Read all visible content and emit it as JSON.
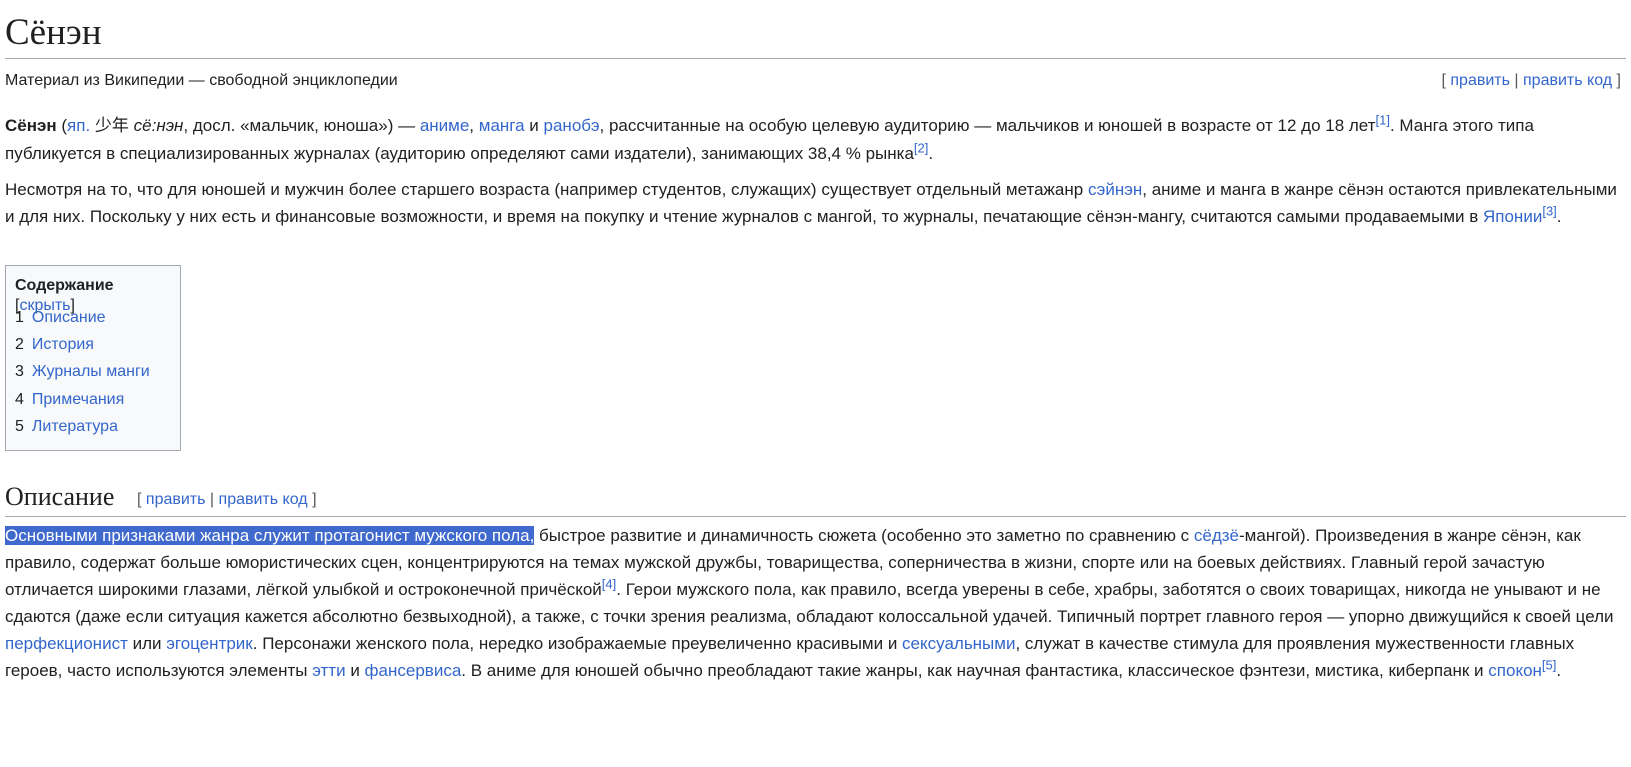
{
  "page": {
    "title": "Сёнэн",
    "tagline": "Материал из Википедии — свободной энциклопедии",
    "edit_links": {
      "open": "[",
      "edit": "править",
      "sep": "|",
      "edit_source": "править код",
      "close": "]"
    }
  },
  "paragraph1": {
    "term": "Сёнэн",
    "t1": " (",
    "lang_link": "яп.",
    "t2": " ",
    "kanji": "少年",
    "t3": " ",
    "romaji": "сё:нэн",
    "t4": ", досл. «мальчик, юноша») — ",
    "link_anime": "аниме",
    "t5": ", ",
    "link_manga": "манга",
    "t6": " и ",
    "link_ranobe": "ранобэ",
    "t7": ", рассчитанные на особую целевую аудиторию — мальчиков и юношей в возрасте от 12 до 18 лет",
    "ref1": "[1]",
    "t8": ". Манга этого типа публикуется в специализированных журналах (аудиторию определяют сами издатели), занимающих 38,4 % рынка",
    "ref2": "[2]",
    "t9": "."
  },
  "paragraph2": {
    "t1": "Несмотря на то, что для юношей и мужчин более старшего возраста (например студентов, служащих) существует отдельный метажанр ",
    "link_seinen": "сэйнэн",
    "t2": ", аниме и манга в жанре сёнэн остаются привлекательными и для них. Поскольку у них есть и финансовые возможности, и время на покупку и чтение журналов с мангой, то журналы, печатающие сёнэн-мангу, считаются самыми продаваемыми в ",
    "link_japan": "Японии",
    "ref3": "[3]",
    "t3": "."
  },
  "toc": {
    "title": "Содержание",
    "toggle_open": "[",
    "toggle": "скрыть",
    "toggle_close": "]",
    "items": [
      {
        "num": "1",
        "label": "Описание"
      },
      {
        "num": "2",
        "label": "История"
      },
      {
        "num": "3",
        "label": "Журналы манги"
      },
      {
        "num": "4",
        "label": "Примечания"
      },
      {
        "num": "5",
        "label": "Литература"
      }
    ]
  },
  "section": {
    "heading": "Описание",
    "edit_links": {
      "open": "[",
      "edit": "править",
      "sep": "|",
      "edit_source": "править код",
      "close": "]"
    }
  },
  "paragraph3": {
    "highlight": "Основными признаками жанра служит протагонист мужского пола,",
    "t1": " быстрое развитие и динамичность сюжета (особенно это заметно по сравнению с ",
    "link_sedze": "сёдзё",
    "t2": "-мангой). Произведения в жанре сёнэн, как правило, содержат больше юмористических сцен, концентрируются на темах мужской дружбы, товарищества, соперничества в жизни, спорте или на боевых действиях. Главный герой зачастую отличается широкими глазами, лёгкой улыбкой и остроконечной причёской",
    "ref4": "[4]",
    "t3": ". Герои мужского пола, как правило, всегда уверены в себе, храбры, заботятся о своих товарищах, никогда не унывают и не сдаются (даже если ситуация кажется абсолютно безвыходной), а также, с точки зрения реализма, обладают колоссальной удачей. Типичный портрет главного героя — упорно движущийся к своей цели ",
    "link_perfectionist": "перфекционист",
    "t4": " или ",
    "link_egocentric": "эгоцентрик",
    "t5": ". Персонажи женского пола, нередко изображаемые преувеличенно красивыми и ",
    "link_sexual": "сексуальными",
    "t6": ", служат в качестве стимула для проявления мужественности главных героев, часто используются элементы ",
    "link_ecchi": "этти",
    "t7": " и ",
    "link_fanservice": "фансервиса",
    "t8": ". В аниме для юношей обычно преобладают такие жанры, как научная фантастика, классическое фэнтези, мистика, киберпанк и ",
    "link_spokon": "спокон",
    "ref5": "[5]",
    "t9": "."
  },
  "colors": {
    "link": "#3366cc",
    "text": "#202122",
    "selection": "#3f69cc",
    "rule": "#a2a9b1"
  }
}
